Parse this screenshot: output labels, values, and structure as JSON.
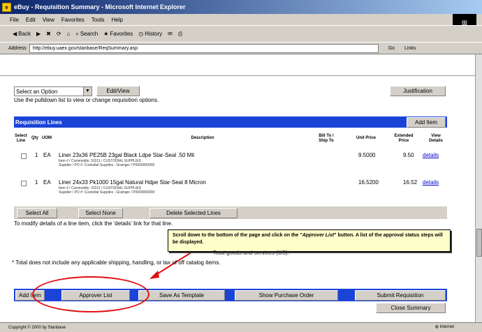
{
  "window": {
    "title": "eBuy - Requisition Summary - Microsoft Internet Explorer"
  },
  "menu": [
    "File",
    "Edit",
    "View",
    "Favorites",
    "Tools",
    "Help"
  ],
  "toolbar": {
    "back": "Back",
    "search": "Search",
    "favorites": "Favorites",
    "history": "History"
  },
  "address": {
    "label": "Address",
    "url": "http://ebuy.uaex.gov/stanbase/ReqSummary.asp",
    "go": "Go",
    "links": "Links"
  },
  "options": {
    "select_value": "Select an Option",
    "edit_view": "Edit/View",
    "justification": "Justification",
    "hint": "Use the pulldown list to view or change requisition options."
  },
  "section": {
    "title": "Requisition Lines",
    "add_item": "Add Item"
  },
  "columns": {
    "select": "Select Line",
    "qty": "Qty",
    "uom": "UOM",
    "description": "Description",
    "billto": "Bill To / Ship To",
    "unit_price": "Unit Price",
    "ext_price": "Extended Price",
    "view": "View Details"
  },
  "lines": [
    {
      "qty": "1",
      "uom": "EA",
      "desc": "Liner 23x36 PE25B 23gal Black Ldpe Star-Seal .50 Mil",
      "item": "Item # / Commodity: 31011 / CUSTODIAL SUPPLIES",
      "supplier": "Supplier / PO #: Custodial Supplies - Grainger / P0000000000",
      "unit_price": "9.5000",
      "ext_price": "9.50",
      "details": "details"
    },
    {
      "qty": "1",
      "uom": "EA",
      "desc": "Liner 24x33 Pk1000 15gal Natural Hdpe Star-Seal 8 Micron",
      "item": "Item # / Commodity: 31011 / CUSTODIAL SUPPLIES",
      "supplier": "Supplier / PO #: Custodial Supplies - Grainger / P0000000000",
      "unit_price": "16.5200",
      "ext_price": "16.52",
      "details": "details"
    }
  ],
  "line_actions": {
    "select_all": "Select All",
    "select_none": "Select None",
    "delete_selected": "Delete Selected Lines",
    "hint": "To modify details of a line item, click the 'details' link for that line."
  },
  "tooltip": {
    "text_before": "Scroll down to the bottom of the page and click on the \"",
    "text_em": "Approver List",
    "text_after": "\" button. A list of the approval status steps will be displayed."
  },
  "totals": {
    "catalog_line": "Total goods and services (US):",
    "footnote": "* Total does not include any applicable shipping, handling, or tax of off catalog items."
  },
  "bottom_actions": {
    "add_item": "Add Item",
    "approver_list": "Approver List",
    "save_template": "Save As Template",
    "show_po": "Show Purchase Order",
    "submit": "Submit Requisition",
    "close": "Close Summary"
  },
  "status": {
    "left": "Copyright © 2000 by Stanbase",
    "zone": "Internet"
  },
  "colors": {
    "section_bar": "#1a44d8",
    "annotation": "#e01010",
    "tooltip_bg": "#ffffcc"
  }
}
